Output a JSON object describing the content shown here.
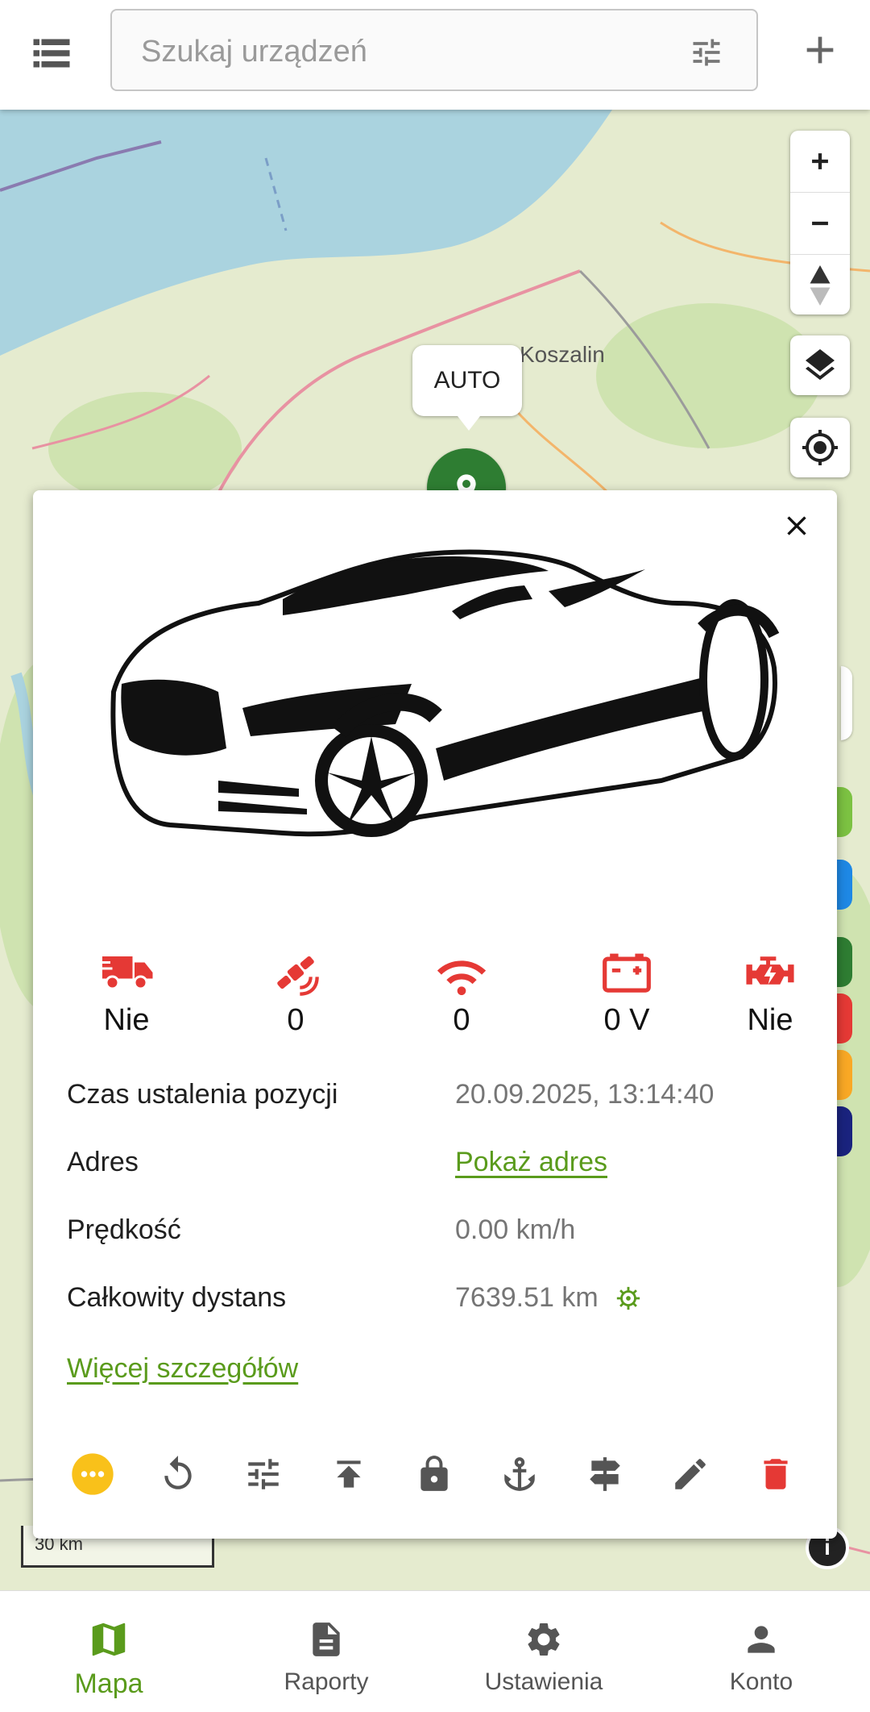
{
  "header": {
    "search_placeholder": "Szukaj urządzeń",
    "menu_icon": "list-icon",
    "filter_icon": "tune-icon",
    "add_icon": "plus-icon"
  },
  "map": {
    "city_label": "Koszalin",
    "marker_label": "AUTO",
    "scale_label": "30 km",
    "controls": [
      "zoom-in",
      "zoom-out",
      "compass",
      "layers",
      "locate"
    ]
  },
  "card": {
    "stats": [
      {
        "icon": "truck-icon",
        "value": "Nie"
      },
      {
        "icon": "satellite-icon",
        "value": "0"
      },
      {
        "icon": "wifi-icon",
        "value": "0"
      },
      {
        "icon": "battery-icon",
        "value": "0 V"
      },
      {
        "icon": "engine-icon",
        "value": "Nie"
      }
    ],
    "rows": [
      {
        "label": "Czas ustalenia pozycji",
        "value": "20.09.2025, 13:14:40"
      },
      {
        "label": "Adres",
        "value": "Pokaż adres"
      },
      {
        "label": "Prędkość",
        "value": "0.00 km/h"
      },
      {
        "label": "Całkowity dystans",
        "value": "7639.51 km"
      }
    ],
    "more_link": "Więcej szczegółów",
    "actions": [
      "more-icon",
      "replay-icon",
      "tune-icon",
      "upload-icon",
      "lock-icon",
      "anchor-icon",
      "signpost-icon",
      "edit-icon",
      "delete-icon"
    ]
  },
  "nav": [
    {
      "label": "Mapa",
      "icon": "map-icon",
      "active": true
    },
    {
      "label": "Raporty",
      "icon": "document-icon",
      "active": false
    },
    {
      "label": "Ustawienia",
      "icon": "gear-icon",
      "active": false
    },
    {
      "label": "Konto",
      "icon": "person-icon",
      "active": false
    }
  ],
  "colors": {
    "accent": "#5a9b1c",
    "alert": "#e53935",
    "marker": "#2e7d32",
    "more_button": "#f9c11a"
  }
}
